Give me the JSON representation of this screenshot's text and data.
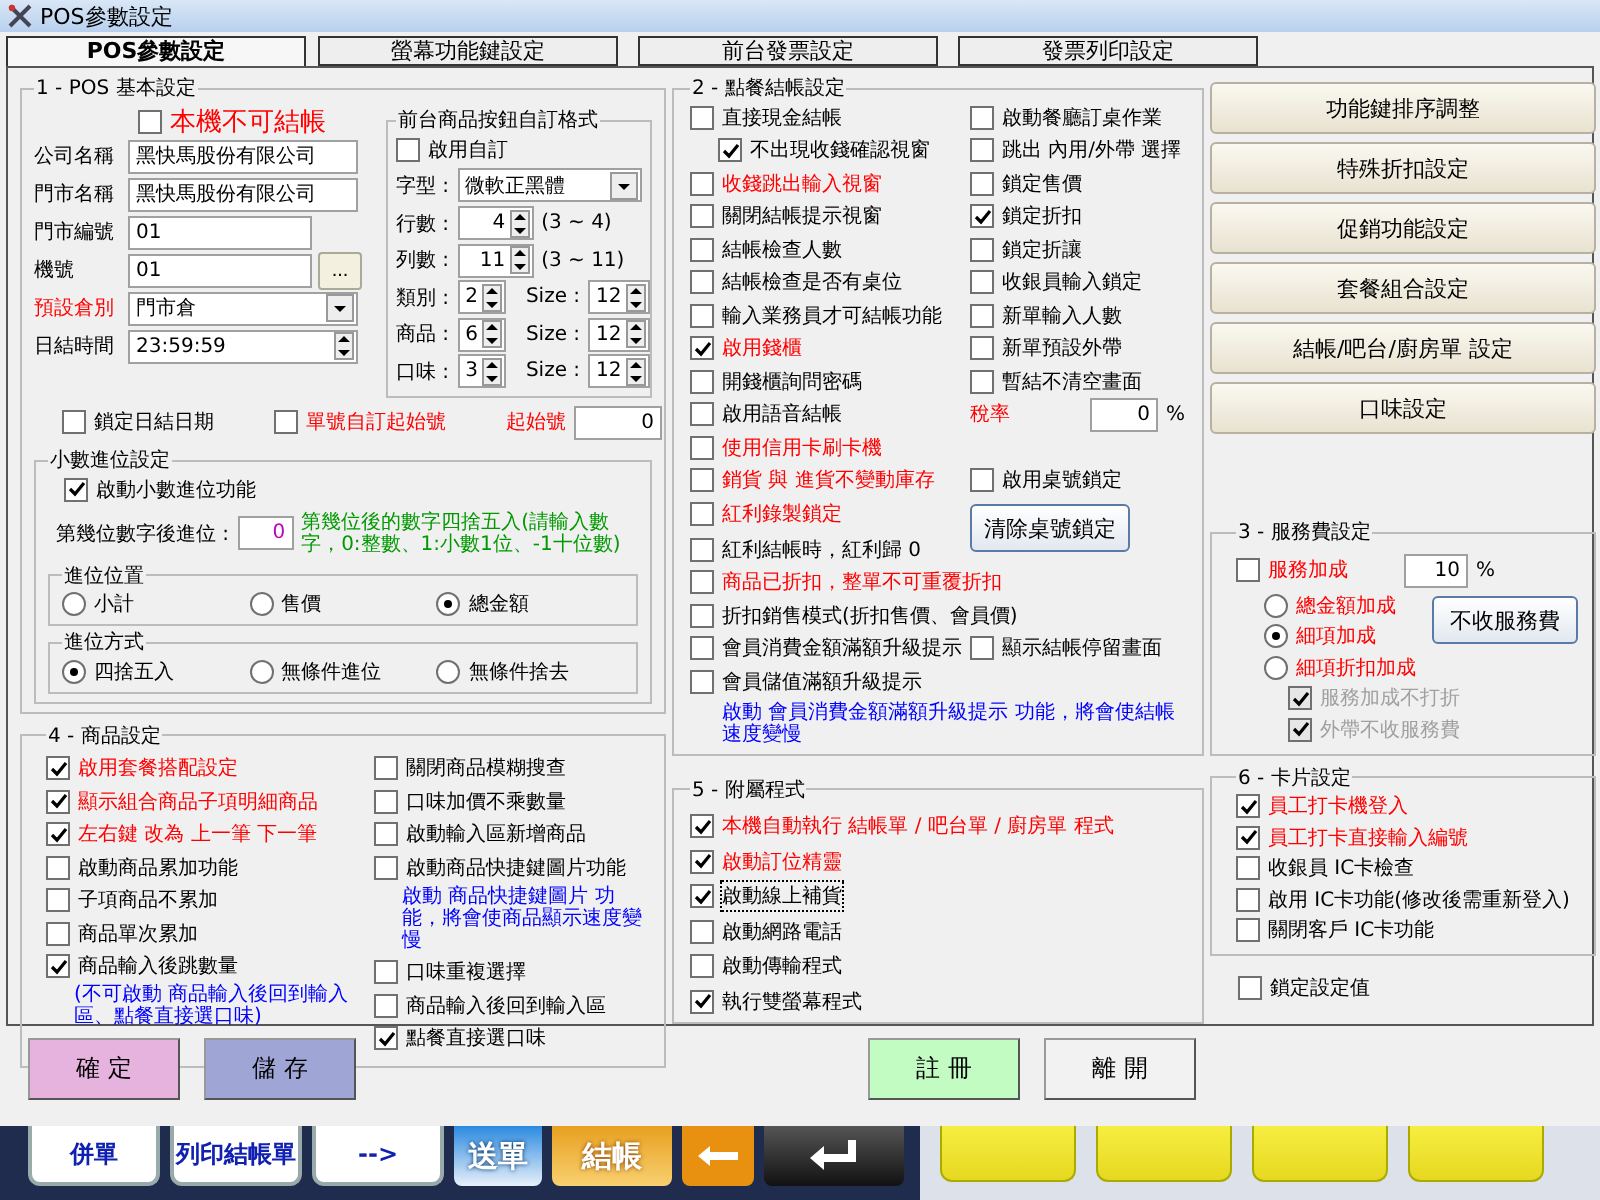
{
  "window": {
    "title": "POS參數設定"
  },
  "tabs": [
    {
      "label": "POS參數設定",
      "selected": true
    },
    {
      "label": "螢幕功能鍵設定",
      "selected": false
    },
    {
      "label": "前台發票設定",
      "selected": false
    },
    {
      "label": "發票列印設定",
      "selected": false
    }
  ],
  "basic": {
    "title": "1 - POS 基本設定",
    "no_checkout": {
      "label": "本機不可結帳",
      "checked": false,
      "color": "#ff0000"
    },
    "fields": [
      {
        "kind": "text",
        "label": "公司名稱",
        "value": "黑快馬股份有限公司",
        "color": "#000000"
      },
      {
        "kind": "text",
        "label": "門市名稱",
        "value": "黑快馬股份有限公司",
        "color": "#000000"
      },
      {
        "kind": "short",
        "label": "門市編號",
        "value": "01",
        "color": "#000000"
      },
      {
        "kind": "browse",
        "label": "機號",
        "value": "01",
        "button": "...",
        "color": "#000000"
      },
      {
        "kind": "select",
        "label": "預設倉別",
        "value": "門市倉",
        "color": "#ff0000"
      },
      {
        "kind": "time",
        "label": "日結時間",
        "value": "23:59:59",
        "color": "#000000"
      }
    ],
    "button_format": {
      "title": "前台商品按鈕自訂格式",
      "enable": {
        "label": "啟用自訂",
        "checked": false,
        "color": "#000000"
      },
      "font": {
        "label": "字型 :",
        "value": "微軟正黑體"
      },
      "rows": [
        {
          "kind": "range",
          "label": "行數 :",
          "value": "4",
          "hint": "(3 ~ 4)"
        },
        {
          "kind": "range",
          "label": "列數 :",
          "value": "11",
          "hint": "(3 ~ 11)"
        },
        {
          "kind": "size",
          "label": "類別 :",
          "value": "2",
          "size_label": "Size :",
          "size": "12"
        },
        {
          "kind": "size",
          "label": "商品 :",
          "value": "6",
          "size_label": "Size :",
          "size": "12"
        },
        {
          "kind": "size",
          "label": "口味 :",
          "value": "3",
          "size_label": "Size :",
          "size": "12"
        }
      ]
    },
    "lock_date": {
      "label": "鎖定日結日期",
      "checked": false,
      "color": "#000000"
    },
    "custom_start": {
      "label": "單號自訂起始號",
      "checked": false,
      "color": "#ff0000"
    },
    "start_number": {
      "label": "起始號",
      "value": "0"
    },
    "decimal": {
      "title": "小數進位設定",
      "enable": {
        "label": "啟動小數進位功能",
        "checked": true,
        "color": "#000000"
      },
      "digits": {
        "label": "第幾位數字後進位 :",
        "value": "0"
      },
      "note": "第幾位後的數字四捨五入(請輸入數字，0:整數、1:小數1位、-1十位數)",
      "position": {
        "title": "進位位置",
        "options": [
          {
            "label": "小計",
            "selected": false
          },
          {
            "label": "售價",
            "selected": false
          },
          {
            "label": "總金額",
            "selected": true
          }
        ]
      },
      "method": {
        "title": "進位方式",
        "options": [
          {
            "label": "四捨五入",
            "selected": true
          },
          {
            "label": "無條件進位",
            "selected": false
          },
          {
            "label": "無條件捨去",
            "selected": false
          }
        ]
      }
    }
  },
  "products": {
    "title": "4 - 商品設定",
    "left": [
      {
        "kind": "check",
        "label": "啟用套餐搭配設定",
        "checked": true,
        "color": "#ff0000"
      },
      {
        "kind": "check",
        "label": "顯示組合商品子項明細商品",
        "checked": true,
        "color": "#ff0000"
      },
      {
        "kind": "check",
        "label": "左右鍵 改為 上一筆 下一筆",
        "checked": true,
        "color": "#ff0000"
      },
      {
        "kind": "check",
        "label": "啟動商品累加功能",
        "checked": false,
        "color": "#000000"
      },
      {
        "kind": "check",
        "label": "子項商品不累加",
        "checked": false,
        "color": "#000000"
      },
      {
        "kind": "check",
        "label": "商品單次累加",
        "checked": false,
        "color": "#000000"
      },
      {
        "kind": "check",
        "label": "商品輸入後跳數量",
        "checked": true,
        "color": "#000000"
      },
      {
        "kind": "note",
        "label": "(不可啟動 商品輸入後回到輸入區、點餐直接選口味)"
      }
    ],
    "right": [
      {
        "kind": "check",
        "label": "關閉商品模糊搜查",
        "checked": false,
        "color": "#000000"
      },
      {
        "kind": "check",
        "label": "口味加價不乘數量",
        "checked": false,
        "color": "#000000"
      },
      {
        "kind": "check",
        "label": "啟動輸入區新增商品",
        "checked": false,
        "color": "#000000"
      },
      {
        "kind": "check",
        "label": "啟動商品快捷鍵圖片功能",
        "checked": false,
        "color": "#000000"
      },
      {
        "kind": "note",
        "label": "啟動 商品快捷鍵圖片 功能，將會使商品顯示速度變慢"
      },
      {
        "kind": "check",
        "label": "口味重複選擇",
        "checked": false,
        "color": "#000000"
      },
      {
        "kind": "check",
        "label": "商品輸入後回到輸入區",
        "checked": false,
        "color": "#000000"
      },
      {
        "kind": "check",
        "label": "點餐直接選口味",
        "checked": true,
        "color": "#000000"
      }
    ]
  },
  "checkout": {
    "title": "2 - 點餐結帳設定",
    "rows": [
      {
        "left": {
          "kind": "check",
          "label": "直接現金結帳",
          "checked": false,
          "color": "#000000"
        },
        "right": {
          "kind": "check",
          "label": "啟動餐廳訂桌作業",
          "checked": false
        }
      },
      {
        "left": {
          "kind": "sub",
          "label": "不出現收錢確認視窗",
          "checked": true,
          "color": "#000000"
        },
        "right": {
          "kind": "check",
          "label": "跳出 內用/外帶 選擇",
          "checked": false
        }
      },
      {
        "left": {
          "kind": "check",
          "label": "收錢跳出輸入視窗",
          "checked": false,
          "color": "#ff0000"
        },
        "right": {
          "kind": "check",
          "label": "鎖定售價",
          "checked": false
        }
      },
      {
        "left": {
          "kind": "check",
          "label": "關閉結帳提示視窗",
          "checked": false,
          "color": "#000000"
        },
        "right": {
          "kind": "check",
          "label": "鎖定折扣",
          "checked": true
        }
      },
      {
        "left": {
          "kind": "check",
          "label": "結帳檢查人數",
          "checked": false,
          "color": "#000000"
        },
        "right": {
          "kind": "check",
          "label": "鎖定折讓",
          "checked": false
        }
      },
      {
        "left": {
          "kind": "check",
          "label": "結帳檢查是否有桌位",
          "checked": false,
          "color": "#000000"
        },
        "right": {
          "kind": "check",
          "label": "收銀員輸入鎖定",
          "checked": false
        }
      },
      {
        "left": {
          "kind": "check",
          "label": "輸入業務員才可結帳功能",
          "checked": false,
          "color": "#000000"
        },
        "right": {
          "kind": "check",
          "label": "新單輸入人數",
          "checked": false
        }
      },
      {
        "left": {
          "kind": "check",
          "label": "啟用錢櫃",
          "checked": true,
          "color": "#ff0000"
        },
        "right": {
          "kind": "check",
          "label": "新單預設外帶",
          "checked": false
        }
      },
      {
        "left": {
          "kind": "check",
          "label": "開錢櫃詢問密碼",
          "checked": false,
          "color": "#000000"
        },
        "right": {
          "kind": "check",
          "label": "暫結不清空畫面",
          "checked": false
        }
      },
      {
        "left": {
          "kind": "check",
          "label": "啟用語音結帳",
          "checked": false,
          "color": "#000000"
        },
        "right": {
          "kind": "rate",
          "label": "稅率",
          "value": "0",
          "unit": "%"
        }
      },
      {
        "left": {
          "kind": "check",
          "label": "使用信用卡刷卡機",
          "checked": false,
          "color": "#ff0000"
        }
      },
      {
        "left": {
          "kind": "check",
          "label": "銷貨 與 進貨不變動庫存",
          "checked": false,
          "color": "#ff0000"
        },
        "right": {
          "kind": "check",
          "label": "啟用桌號鎖定",
          "checked": false
        }
      },
      {
        "left": {
          "kind": "check",
          "label": "紅利錄製鎖定",
          "checked": false,
          "color": "#ff0000"
        },
        "right": {
          "kind": "button",
          "label": "清除桌號鎖定"
        }
      },
      {
        "left": {
          "kind": "check",
          "label": "紅利結帳時，紅利歸 0",
          "checked": false,
          "color": "#000000"
        }
      },
      {
        "left": {
          "kind": "check",
          "label": "商品已折扣，整單不可重覆折扣",
          "checked": false,
          "color": "#ff0000"
        }
      },
      {
        "left": {
          "kind": "check",
          "label": "折扣銷售模式(折扣售價、會員價)",
          "checked": false,
          "color": "#000000"
        }
      },
      {
        "left": {
          "kind": "check",
          "label": "會員消費金額滿額升級提示",
          "checked": false,
          "color": "#000000"
        },
        "right": {
          "kind": "check",
          "label": "顯示結帳停留畫面",
          "checked": false
        }
      },
      {
        "left": {
          "kind": "check",
          "label": "會員儲值滿額升級提示",
          "checked": false,
          "color": "#000000"
        }
      }
    ],
    "note": "啟動 會員消費金額滿額升級提示 功能，將會使結帳速度變慢"
  },
  "attachments": {
    "title": "5 - 附屬程式",
    "items": [
      {
        "label": "本機自動執行 結帳單 / 吧台單 / 廚房單 程式",
        "checked": true,
        "color": "#ff0000",
        "focused": false
      },
      {
        "label": "啟動訂位精靈",
        "checked": true,
        "color": "#ff0000",
        "focused": false
      },
      {
        "label": "啟動線上補貨",
        "checked": true,
        "color": "#000000",
        "focused": true
      },
      {
        "label": "啟動網路電話",
        "checked": false,
        "color": "#000000",
        "focused": false
      },
      {
        "label": "啟動傳輸程式",
        "checked": false,
        "color": "#000000",
        "focused": false
      },
      {
        "label": "執行雙螢幕程式",
        "checked": true,
        "color": "#000000",
        "focused": false
      }
    ]
  },
  "side_buttons": [
    "功能鍵排序調整",
    "特殊折扣設定",
    "促銷功能設定",
    "套餐組合設定",
    "結帳/吧台/廚房單 設定",
    "口味設定"
  ],
  "service": {
    "title": "3 - 服務費設定",
    "enable": {
      "label": "服務加成",
      "checked": false,
      "color": "#ff0000"
    },
    "rate": "10",
    "unit": "%",
    "options": [
      {
        "label": "總金額加成",
        "selected": false
      },
      {
        "label": "細項加成",
        "selected": true
      },
      {
        "label": "細項折扣加成",
        "selected": false
      }
    ],
    "button": "不收服務費",
    "sub": [
      {
        "label": "服務加成不打折",
        "checked": true,
        "disabled": true
      },
      {
        "label": "外帶不收服務費",
        "checked": true,
        "disabled": true
      }
    ]
  },
  "cards": {
    "title": "6 - 卡片設定",
    "items": [
      {
        "label": "員工打卡機登入",
        "checked": true,
        "color": "#ff0000"
      },
      {
        "label": "員工打卡直接輸入編號",
        "checked": true,
        "color": "#ff0000"
      },
      {
        "label": "收銀員 IC卡檢查",
        "checked": false,
        "color": "#000000"
      },
      {
        "label": "啟用 IC卡功能(修改後需重新登入)",
        "checked": false,
        "color": "#000000"
      },
      {
        "label": "關閉客戶 IC卡功能",
        "checked": false,
        "color": "#000000"
      }
    ]
  },
  "lock_settings": {
    "label": "鎖定設定值",
    "checked": false,
    "color": "#000000"
  },
  "footer_buttons": [
    {
      "label": "確 定",
      "color": "#e6b2de"
    },
    {
      "label": "儲 存",
      "color": "#9fa6d6"
    },
    {
      "label": "註 冊",
      "color": "#c2fcc2"
    },
    {
      "label": "離 開",
      "color": "#f2f2f2"
    }
  ],
  "taskbar": [
    {
      "kind": "text",
      "label": "併單"
    },
    {
      "kind": "text",
      "label": "列印結帳單"
    },
    {
      "kind": "text",
      "label": "-->"
    },
    {
      "kind": "send",
      "label": "送單"
    },
    {
      "kind": "pay",
      "label": "結帳"
    },
    {
      "kind": "back"
    },
    {
      "kind": "enter"
    },
    {
      "kind": "blank"
    },
    {
      "kind": "blank"
    },
    {
      "kind": "blank"
    },
    {
      "kind": "blank"
    }
  ]
}
